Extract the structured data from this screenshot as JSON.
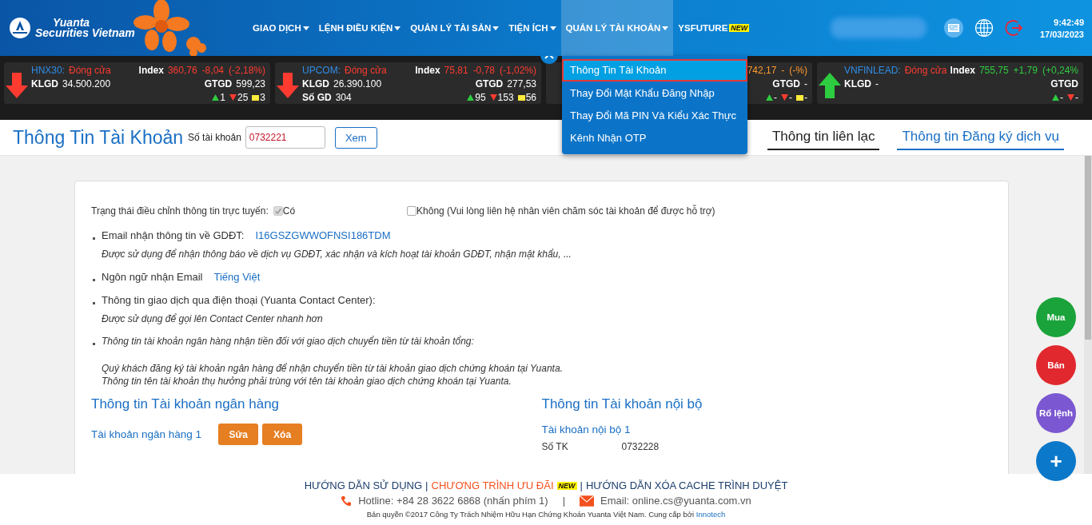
{
  "header": {
    "logo": {
      "line1": "Yuanta",
      "line2": "Securities Vietnam"
    },
    "nav": [
      {
        "label": "GIAO DỊCH",
        "selected": false,
        "caret": true
      },
      {
        "label": "LỆNH ĐIỀU KIỆN",
        "selected": false,
        "caret": true
      },
      {
        "label": "QUẢN LÝ TÀI SẢN",
        "selected": false,
        "caret": true
      },
      {
        "label": "TIỆN ÍCH",
        "selected": false,
        "caret": true
      },
      {
        "label": "QUẢN LÝ TÀI KHOẢN",
        "selected": true,
        "caret": true
      },
      {
        "label": "YSFUTURE",
        "selected": false,
        "caret": false,
        "badge": "NEW"
      }
    ],
    "time": "9:42:49",
    "date": "17/03/2023"
  },
  "tickers": [
    {
      "kind": "down",
      "name": "HNX30:",
      "status": "Đóng cửa",
      "index_label": "Index",
      "index_value": "360,76",
      "change": "-8,04",
      "pct": "(-2,18%)",
      "klgd_label": "KLGD",
      "klgd": "34.500.200",
      "gtgd_label": "GTGD",
      "gtgd": "599,23",
      "up": "1",
      "down": "25",
      "flat": "3"
    },
    {
      "kind": "down",
      "name": "UPCOM:",
      "status": "Đóng cửa",
      "index_label": "Index",
      "index_value": "75,81",
      "change": "-0,78",
      "pct": "(-1,02%)",
      "klgd_label": "KLGD",
      "klgd": "26.390.100",
      "gtgd_label": "GTGD",
      "gtgd": "277,53",
      "sogd_label": "Số GD",
      "sogd": "304",
      "up": "95",
      "down": "153",
      "flat": "56"
    },
    {
      "kind": "flat",
      "index_value": "742,17",
      "change": "-",
      "pct": "(-%)",
      "gtgd_label": "GTGD",
      "gtgd": "-",
      "up": "-",
      "down": "-",
      "flat": "-"
    },
    {
      "kind": "up",
      "name": "VNFINLEAD:",
      "status": "Đóng cửa",
      "index_label": "Index",
      "index_value": "755,75",
      "change": "+1,79",
      "pct": "(+0,24%",
      "klgd_label": "KLGD",
      "klgd": "-",
      "gtgd_label": "GTGD",
      "up": "-",
      "down": "-"
    }
  ],
  "dropdown": [
    {
      "label": "Thông Tin Tài Khoản",
      "selected": true
    },
    {
      "label": "Thay Đổi Mật Khẩu Đăng Nhập",
      "selected": false
    },
    {
      "label": "Thay Đổi Mã PIN Và Kiểu Xác Thực",
      "selected": false
    },
    {
      "label": "Kênh Nhận OTP",
      "selected": false
    }
  ],
  "title_bar": {
    "title": "Thông Tin Tài Khoản",
    "account_label": "Số tài khoản",
    "account_value": "0732221",
    "view_button": "Xem",
    "tabs": [
      {
        "label": "Thông tin liên lạc",
        "selected": false
      },
      {
        "label": "Thông tin Đăng ký dịch vụ",
        "selected": true
      }
    ]
  },
  "card": {
    "status_label": "Trạng thái điều chỉnh thông tin trực tuyến:",
    "options": [
      {
        "label": "Có",
        "checked": true,
        "disabled": true
      },
      {
        "label": "Không (Vui lòng liên hệ nhân viên chăm sóc tài khoản để được hỗ trợ)",
        "checked": false,
        "disabled": false
      }
    ],
    "items": [
      {
        "label": "Email nhận thông tin về GDĐT:",
        "value": "I16GSZGWWOFNSI186TDM",
        "italic": false,
        "notes": [
          "Được sử dụng để nhận thông báo về dịch vụ GDĐT, xác nhận và kích hoạt tài khoản GDĐT, nhận mật khẩu, ..."
        ]
      },
      {
        "label": "Ngôn ngữ nhận Email",
        "value": "Tiếng Việt",
        "italic": false
      },
      {
        "label": "Thông tin giao dịch qua điện thoại (Yuanta Contact Center):",
        "italic": false,
        "notes": [
          "Được sử dụng để gọi lên Contact Center nhanh hơn"
        ]
      },
      {
        "label": "Thông tin tài khoản ngân hàng nhận tiền đối với giao dịch chuyển tiền từ tài khoản tổng:",
        "italic": true,
        "notes": [
          "Quý khách đăng ký tài khoản ngân hàng để nhận chuyển tiền từ tài khoản giao dịch chứng khoán tại Yuanta.",
          "Thông tin tên tài khoản thụ hưởng phải trùng với tên tài khoản giao dịch chứng khoán tại Yuanta."
        ]
      }
    ],
    "bank": {
      "title": "Thông tin Tài khoản ngân hàng",
      "account": "Tài khoản ngân hàng 1",
      "buttons": [
        "Sửa",
        "Xóa"
      ]
    },
    "internal": {
      "title": "Thông tin Tài khoản nội bộ",
      "account": "Tài khoản nội bộ 1",
      "field_label": "Số TK",
      "field_value": "0732228"
    }
  },
  "fabs": [
    {
      "label": "Mua",
      "color": "#1aa33a"
    },
    {
      "label": "Bán",
      "color": "#e0282e"
    },
    {
      "label": "Rổ lệnh",
      "color": "#7b57d1"
    },
    {
      "label": "+",
      "color": "#0b78c9"
    }
  ],
  "footer": {
    "links": [
      {
        "label": "HƯỚNG DẪN SỬ DỤNG",
        "kind": "link"
      },
      {
        "label": "|",
        "kind": "sep"
      },
      {
        "label": "CHƯƠNG TRÌNH ƯU ĐÃI",
        "kind": "promo",
        "badge": "NEW"
      },
      {
        "label": "|",
        "kind": "sep"
      },
      {
        "label": "HƯỚNG DẪN XÓA CACHE TRÌNH DUYỆT",
        "kind": "link"
      }
    ],
    "hotline": "Hotline: +84 28 3622 6868 (nhấn phím 1)",
    "separator": "|",
    "email": "Email: online.cs@yuanta.com.vn",
    "copyright": "Bản quyền ©2017 Công Ty Trách Nhiệm Hữu Hạn Chứng Khoán Yuanta Việt Nam. Cung cấp bởi",
    "provider": "Innotech"
  }
}
